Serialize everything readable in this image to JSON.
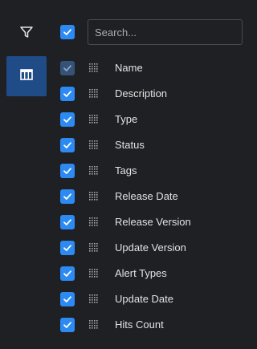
{
  "sidebar": {
    "items": [
      {
        "name": "filter",
        "icon": "filter-icon",
        "active": false
      },
      {
        "name": "columns",
        "icon": "columns-icon",
        "active": true
      }
    ]
  },
  "header": {
    "select_all_checked": true,
    "search": {
      "placeholder": "Search...",
      "value": ""
    }
  },
  "colors": {
    "accent": "#2c8af2",
    "active_tab": "#1f4c86",
    "disabled_check": "#355378"
  },
  "columns": [
    {
      "label": "Name",
      "checked": true,
      "disabled": true
    },
    {
      "label": "Description",
      "checked": true,
      "disabled": false
    },
    {
      "label": "Type",
      "checked": true,
      "disabled": false
    },
    {
      "label": "Status",
      "checked": true,
      "disabled": false
    },
    {
      "label": "Tags",
      "checked": true,
      "disabled": false
    },
    {
      "label": "Release Date",
      "checked": true,
      "disabled": false
    },
    {
      "label": "Release Version",
      "checked": true,
      "disabled": false
    },
    {
      "label": "Update Version",
      "checked": true,
      "disabled": false
    },
    {
      "label": "Alert Types",
      "checked": true,
      "disabled": false
    },
    {
      "label": "Update Date",
      "checked": true,
      "disabled": false
    },
    {
      "label": "Hits Count",
      "checked": true,
      "disabled": false
    }
  ]
}
